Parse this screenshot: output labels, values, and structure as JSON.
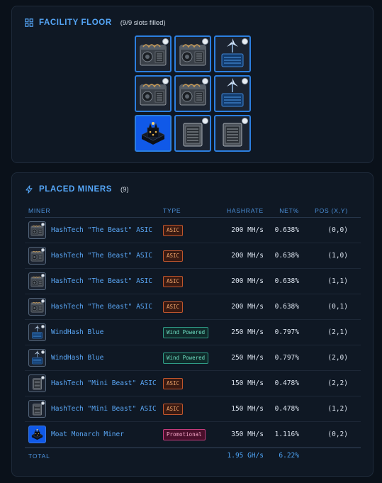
{
  "facility": {
    "title": "FACILITY FLOOR",
    "subtitle": "(9/9 slots filled)",
    "icon": "grid-icon",
    "slots": [
      {
        "kind": "asic-big"
      },
      {
        "kind": "asic-big"
      },
      {
        "kind": "wind"
      },
      {
        "kind": "asic-big"
      },
      {
        "kind": "asic-big"
      },
      {
        "kind": "wind"
      },
      {
        "kind": "promo"
      },
      {
        "kind": "asic-mini"
      },
      {
        "kind": "asic-mini"
      }
    ]
  },
  "placed": {
    "title": "PLACED MINERS",
    "count": "(9)",
    "icon": "lightning-icon",
    "headers": {
      "miner": "MINER",
      "type": "TYPE",
      "hashrate": "HASHRATE",
      "net": "NET%",
      "pos": "POS (X,Y)"
    },
    "rows": [
      {
        "name": "HashTech \"The Beast\" ASIC",
        "type": "ASIC",
        "type_kind": "asic",
        "thumb": "asic-big",
        "hashrate": "200 MH/s",
        "net": "0.638%",
        "pos": "(0,0)"
      },
      {
        "name": "HashTech \"The Beast\" ASIC",
        "type": "ASIC",
        "type_kind": "asic",
        "thumb": "asic-big",
        "hashrate": "200 MH/s",
        "net": "0.638%",
        "pos": "(1,0)"
      },
      {
        "name": "HashTech \"The Beast\" ASIC",
        "type": "ASIC",
        "type_kind": "asic",
        "thumb": "asic-big",
        "hashrate": "200 MH/s",
        "net": "0.638%",
        "pos": "(1,1)"
      },
      {
        "name": "HashTech \"The Beast\" ASIC",
        "type": "ASIC",
        "type_kind": "asic",
        "thumb": "asic-big",
        "hashrate": "200 MH/s",
        "net": "0.638%",
        "pos": "(0,1)"
      },
      {
        "name": "WindHash Blue",
        "type": "Wind Powered",
        "type_kind": "wind",
        "thumb": "wind",
        "hashrate": "250 MH/s",
        "net": "0.797%",
        "pos": "(2,1)"
      },
      {
        "name": "WindHash Blue",
        "type": "Wind Powered",
        "type_kind": "wind",
        "thumb": "wind",
        "hashrate": "250 MH/s",
        "net": "0.797%",
        "pos": "(2,0)"
      },
      {
        "name": "HashTech \"Mini Beast\" ASIC",
        "type": "ASIC",
        "type_kind": "asic",
        "thumb": "asic-mini",
        "hashrate": "150 MH/s",
        "net": "0.478%",
        "pos": "(2,2)"
      },
      {
        "name": "HashTech \"Mini Beast\" ASIC",
        "type": "ASIC",
        "type_kind": "asic",
        "thumb": "asic-mini",
        "hashrate": "150 MH/s",
        "net": "0.478%",
        "pos": "(1,2)"
      },
      {
        "name": "Moat Monarch Miner",
        "type": "Promotional",
        "type_kind": "promo",
        "thumb": "promo",
        "hashrate": "350 MH/s",
        "net": "1.116%",
        "pos": "(0,2)"
      }
    ],
    "total": {
      "label": "TOTAL",
      "hashrate": "1.95 GH/s",
      "net": "6.22%"
    }
  }
}
